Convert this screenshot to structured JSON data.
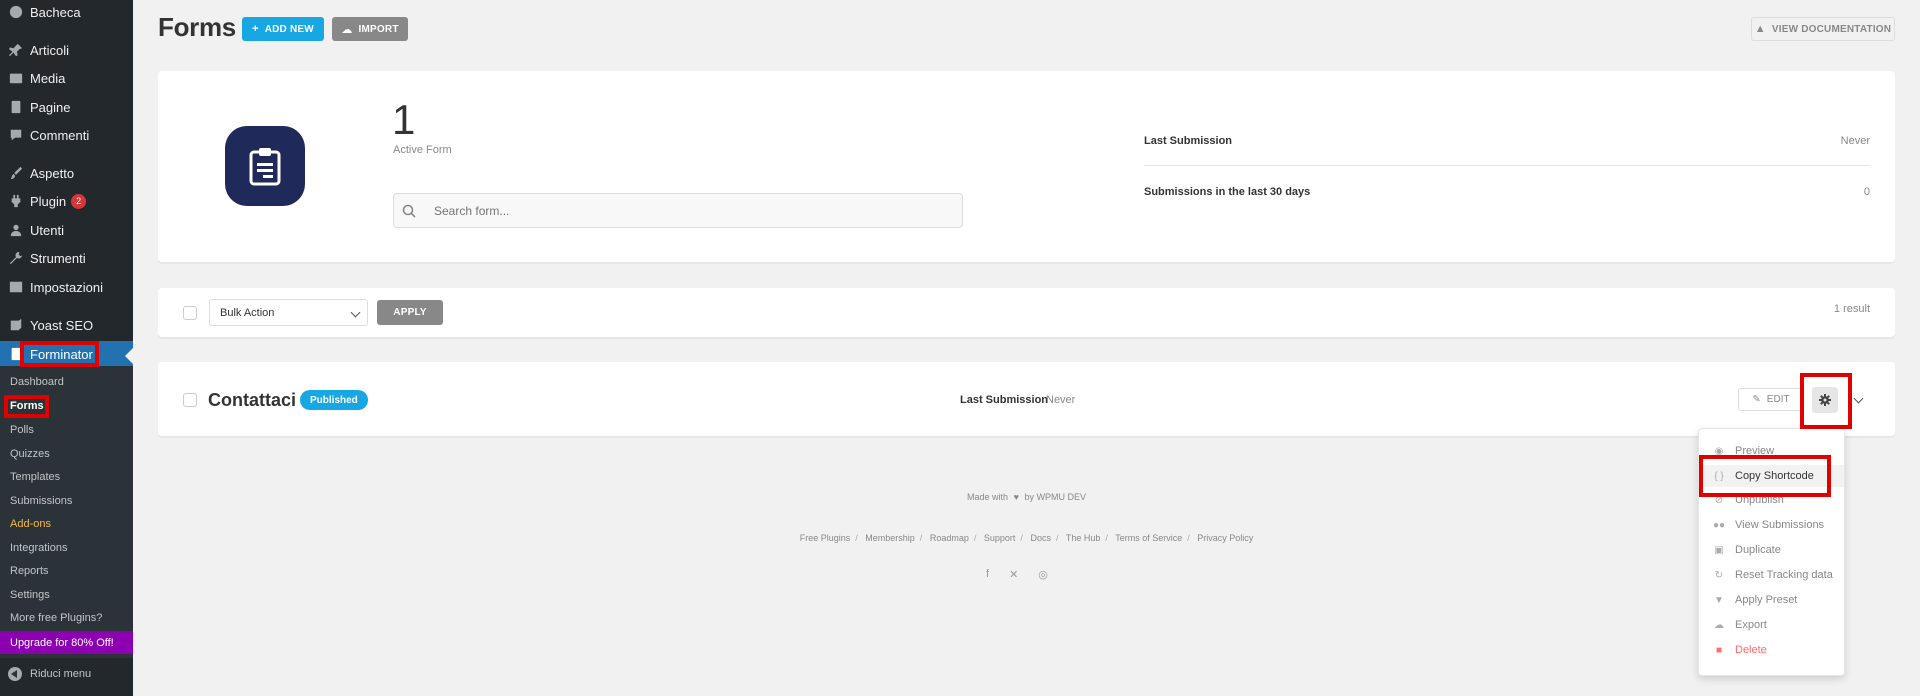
{
  "sidebar": {
    "items": [
      {
        "label": "Bacheca",
        "icon": "dashboard-icon"
      },
      {
        "label": "Articoli",
        "icon": "pin-icon"
      },
      {
        "label": "Media",
        "icon": "media-icon"
      },
      {
        "label": "Pagine",
        "icon": "pages-icon"
      },
      {
        "label": "Commenti",
        "icon": "comment-icon"
      },
      {
        "label": "Aspetto",
        "icon": "brush-icon"
      },
      {
        "label": "Plugin",
        "icon": "plugin-icon",
        "badge": "2"
      },
      {
        "label": "Utenti",
        "icon": "user-icon"
      },
      {
        "label": "Strumenti",
        "icon": "wrench-icon"
      },
      {
        "label": "Impostazioni",
        "icon": "settings-icon"
      },
      {
        "label": "Yoast SEO",
        "icon": "yoast-icon"
      },
      {
        "label": "Forminator",
        "icon": "forminator-icon"
      }
    ],
    "submenu": [
      "Dashboard",
      "Forms",
      "Polls",
      "Quizzes",
      "Templates",
      "Submissions",
      "Add-ons",
      "Integrations",
      "Reports",
      "Settings",
      "More free Plugins?"
    ],
    "upgrade": "Upgrade for 80% Off!",
    "collapse": "Riduci menu"
  },
  "header": {
    "title": "Forms",
    "add_new": "ADD NEW",
    "import": "IMPORT",
    "view_docs": "VIEW DOCUMENTATION"
  },
  "summary": {
    "active_count": "1",
    "active_label": "Active Form",
    "search_placeholder": "Search form...",
    "last_submission_label": "Last Submission",
    "last_submission_value": "Never",
    "last30_label": "Submissions in the last 30 days",
    "last30_value": "0"
  },
  "bulk": {
    "select_value": "Bulk Action",
    "apply": "APPLY",
    "result": "1 result"
  },
  "form_row": {
    "name": "Contattaci",
    "status": "Published",
    "last_submission_label": "Last Submission",
    "last_submission_value": "Never",
    "edit": "EDIT"
  },
  "dropdown": [
    {
      "label": "Preview",
      "icon": "eye-icon"
    },
    {
      "label": "Copy Shortcode",
      "icon": "code-icon"
    },
    {
      "label": "Unpublish",
      "icon": "unpublish-icon"
    },
    {
      "label": "View Submissions",
      "icon": "users-icon"
    },
    {
      "label": "Duplicate",
      "icon": "copy-icon"
    },
    {
      "label": "Reset Tracking data",
      "icon": "refresh-icon"
    },
    {
      "label": "Apply Preset",
      "icon": "brush-icon"
    },
    {
      "label": "Export",
      "icon": "cloud-icon"
    },
    {
      "label": "Delete",
      "icon": "trash-icon"
    }
  ],
  "footer": {
    "made_with": "Made with",
    "by": "by WPMU DEV",
    "links": [
      "Free Plugins",
      "Membership",
      "Roadmap",
      "Support",
      "Docs",
      "The Hub",
      "Terms of Service",
      "Privacy Policy"
    ]
  },
  "colors": {
    "accent": "#17a8e3",
    "sidebar": "#23282d",
    "highlight_box": "#e10000",
    "upgrade": "#8d00b1"
  }
}
